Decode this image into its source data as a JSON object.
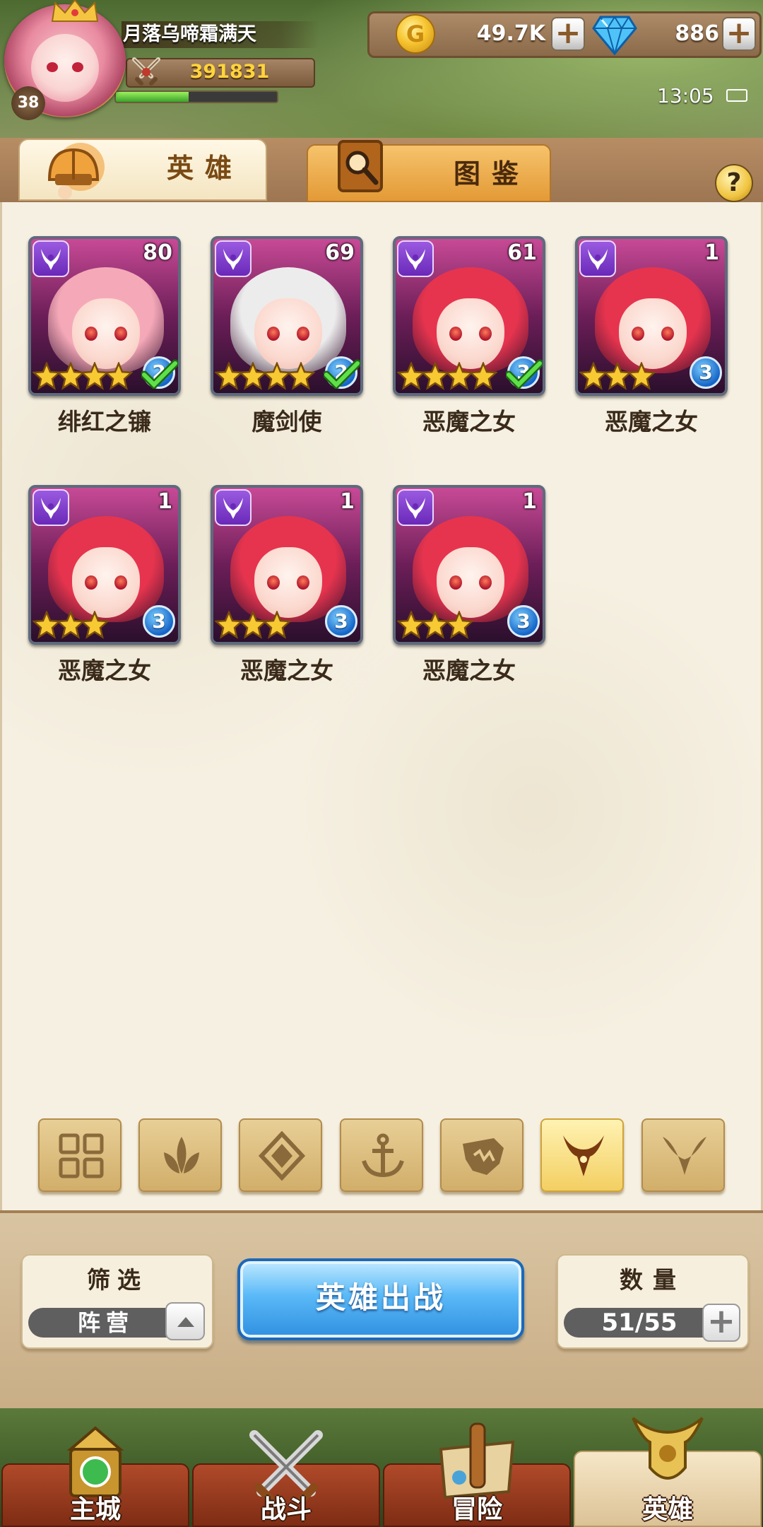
{
  "player": {
    "name": "月落乌啼霜满天",
    "level": "38",
    "power": "391831",
    "exp_fraction": 0.45
  },
  "currency": {
    "gold": "49.7K",
    "gems": "886",
    "add_label": "+"
  },
  "status": {
    "time": "13:05"
  },
  "tabs": [
    {
      "label": "英雄",
      "active": true,
      "icon": "helmet-icon"
    },
    {
      "label": "图鉴",
      "active": false,
      "icon": "magnifier-book-icon"
    }
  ],
  "help_label": "?",
  "heroes": [
    {
      "name": "绯红之镰",
      "level": "80",
      "stars": 4,
      "badge": "2",
      "checked": true,
      "class_icon": "demon-horns-icon",
      "hair": "#f5a9b8"
    },
    {
      "name": "魔剑使",
      "level": "69",
      "stars": 4,
      "badge": "2",
      "checked": true,
      "class_icon": "demon-horns-icon",
      "hair": "#ececec"
    },
    {
      "name": "恶魔之女",
      "level": "61",
      "stars": 4,
      "badge": "3",
      "checked": true,
      "class_icon": "demon-horns-icon",
      "hair": "#e6344e"
    },
    {
      "name": "恶魔之女",
      "level": "1",
      "stars": 3,
      "badge": "3",
      "checked": false,
      "class_icon": "demon-horns-icon",
      "hair": "#e6344e"
    },
    {
      "name": "恶魔之女",
      "level": "1",
      "stars": 3,
      "badge": "3",
      "checked": false,
      "class_icon": "demon-horns-icon",
      "hair": "#e6344e"
    },
    {
      "name": "恶魔之女",
      "level": "1",
      "stars": 3,
      "badge": "3",
      "checked": false,
      "class_icon": "demon-horns-icon",
      "hair": "#e6344e"
    },
    {
      "name": "恶魔之女",
      "level": "1",
      "stars": 3,
      "badge": "3",
      "checked": false,
      "class_icon": "demon-horns-icon",
      "hair": "#e6344e"
    }
  ],
  "faction_filters": [
    {
      "icon": "grid-all-icon",
      "selected": false
    },
    {
      "icon": "leaf-icon",
      "selected": false
    },
    {
      "icon": "diamond-rune-icon",
      "selected": false
    },
    {
      "icon": "anchor-icon",
      "selected": false
    },
    {
      "icon": "beast-head-icon",
      "selected": false
    },
    {
      "icon": "demon-horns-icon",
      "selected": true
    },
    {
      "icon": "wings-icon",
      "selected": false
    }
  ],
  "filter": {
    "title": "筛选",
    "value": "阵营"
  },
  "deploy_button": "英雄出战",
  "capacity": {
    "title": "数量",
    "value": "51/55"
  },
  "bottom_nav": [
    {
      "label": "主城",
      "icon": "castle-icon",
      "active": false
    },
    {
      "label": "战斗",
      "icon": "crossed-swords-icon",
      "active": false
    },
    {
      "label": "冒险",
      "icon": "scroll-map-icon",
      "active": false
    },
    {
      "label": "英雄",
      "icon": "golden-helmet-icon",
      "active": true
    }
  ],
  "colors": {
    "accent_blue": "#2f8fe0",
    "gold_text": "#ffd43b",
    "paper": "#f6f0e2",
    "faction_purple": "#7a3ad0"
  }
}
